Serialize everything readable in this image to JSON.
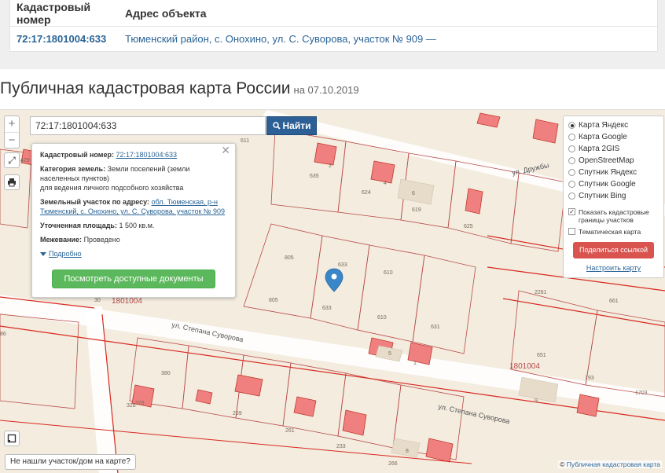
{
  "table": {
    "col_number": "Кадастровый номер",
    "col_address": "Адрес объекта",
    "row": {
      "number": "72:17:1801004:633",
      "address": "Тюменский район, с. Онохино, ул. С. Суворова, участок № 909 —"
    }
  },
  "title": {
    "main": "Публичная кадастровая карта России",
    "date": "на 07.10.2019"
  },
  "zoom": {
    "plus": "+",
    "minus": "−"
  },
  "search": {
    "value": "72:17:1801004:633",
    "button": "Найти"
  },
  "popup": {
    "close": "✕",
    "number_label": "Кадастровый номер:",
    "number_value": "72:17:1801004:633",
    "category_label": "Категория земель:",
    "category_value": "Земли поселений (земли населенных пунктов)",
    "use_value": "для ведения личного подсобного хозяйства",
    "address_label": "Земельный участок по адресу:",
    "address_value": "обл. Тюменская, р-н Тюменский, с. Онохино, ул. С. Суворова, участок № 909",
    "area_label": "Уточненная площадь:",
    "area_value": "1 500 кв.м.",
    "boundary_label": "Межевание:",
    "boundary_value": "Проведено",
    "more": "Подробно",
    "docs_button": "Посмотреть доступные документы"
  },
  "layers": {
    "options": [
      "Карта Яндекс",
      "Карта Google",
      "Карта 2GIS",
      "OpenStreetMap",
      "Спутник Яндекс",
      "Спутник Google",
      "Спутник Bing"
    ],
    "selected": "Карта Яндекс",
    "show_borders": "Показать кадастровые границы участков",
    "thematic": "Тематическая карта",
    "share": "Поделиться ссылкой",
    "configure": "Настроить карту"
  },
  "map_labels": {
    "street_druzhby": "ул. Дружбы",
    "street_suvorova_1": "ул. Степана Суворова",
    "street_suvorova_2": "ул. Степана Суворова",
    "quarter_1": "1801004",
    "quarter_2": "1801004",
    "plots": [
      "611",
      "635",
      "624",
      "619",
      "625",
      "805",
      "633",
      "610",
      "631",
      "805",
      "633",
      "610",
      "651",
      "661",
      "2261",
      "793",
      "1703",
      "380",
      "328",
      "259",
      "261",
      "233",
      "266",
      "8",
      "9",
      "6",
      "5",
      "4",
      "2",
      "1",
      "30",
      "429",
      "86",
      "378"
    ]
  },
  "bottom": {
    "not_found": "Не нашли участок/дом на карте?",
    "attribution_prefix": "©",
    "attribution": "Публичная кадастровая карта"
  },
  "colors": {
    "link": "#2a6496",
    "search_button": "#2c5f95",
    "docs_button": "#5cb85c",
    "share_button": "#d9534f",
    "map_bg": "#f3ecdf",
    "parcel_line": "#c0392b",
    "building": "#f08080"
  }
}
